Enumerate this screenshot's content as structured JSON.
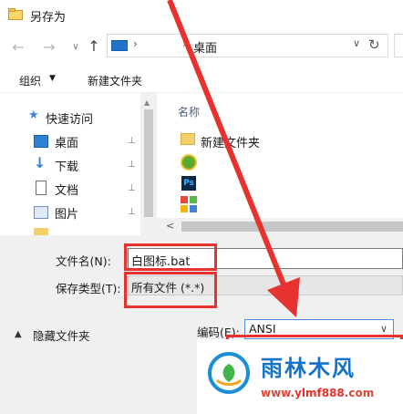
{
  "window": {
    "title": "另存为"
  },
  "nav": {
    "back": "←",
    "forward": "→",
    "recent": "∨",
    "up": "↑",
    "address_crumb": "桌面",
    "chevron": "›",
    "dropdown": "∨",
    "refresh": "↻"
  },
  "toolbar": {
    "organize": "组织",
    "organize_caret": "▼",
    "new_folder": "新建文件夹"
  },
  "sidebar": {
    "quick_access": "快速访问",
    "items": [
      {
        "label": "桌面",
        "icon": "desktop-icon"
      },
      {
        "label": "下载",
        "icon": "download-icon"
      },
      {
        "label": "文档",
        "icon": "documents-icon"
      },
      {
        "label": "图片",
        "icon": "pictures-icon"
      }
    ],
    "pin_glyph": "📌",
    "scroll_up": "▲"
  },
  "files": {
    "column_name": "名称",
    "items": [
      {
        "label": "新建文件夹",
        "icon": "folder-icon"
      },
      {
        "label": "",
        "icon": "app-green-icon"
      },
      {
        "label": "",
        "icon": "photoshop-icon"
      },
      {
        "label": "",
        "icon": "app-colorful-icon"
      }
    ],
    "ps_glyph": "Ps",
    "hscroll_left": "<"
  },
  "form": {
    "filename_label": "文件名(N):",
    "filename_value": "白图标.bat",
    "filetype_label": "保存类型(T):",
    "filetype_value": "所有文件  (*.*)"
  },
  "footer": {
    "hide_folders_caret": "▲",
    "hide_folders": "隐藏文件夹",
    "encoding_label": "编码(E):",
    "encoding_value": "ANSI",
    "encoding_caret": "∨"
  },
  "watermark": {
    "title": "雨林木风",
    "url_prefix": "www.",
    "url_brand": "ylmf888",
    "url_suffix": ".com"
  },
  "colors": {
    "annotation_red": "#e8322f",
    "accent_blue": "#1573c9",
    "form_gray": "#f0f0f0"
  }
}
